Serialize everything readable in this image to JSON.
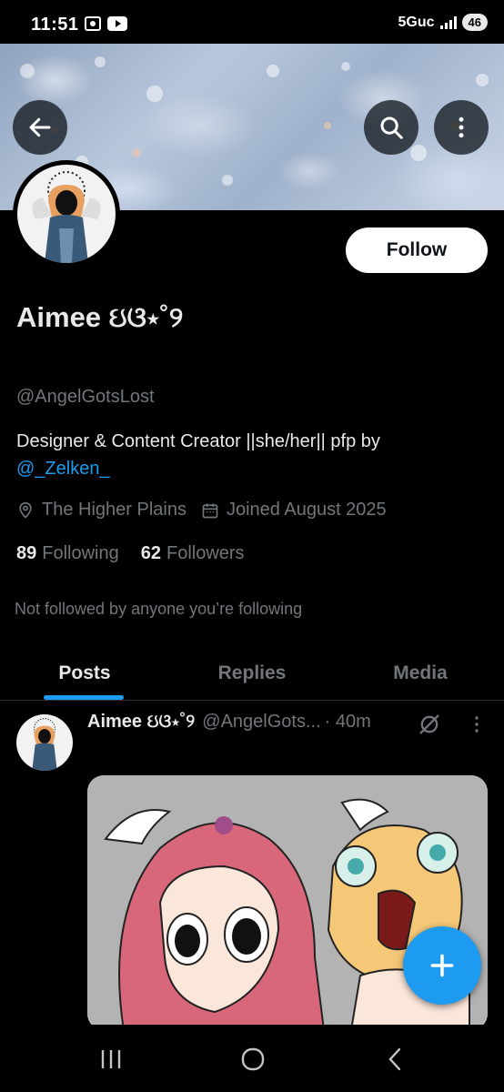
{
  "status_bar": {
    "time": "11:51",
    "network": "5Guc",
    "battery": "46"
  },
  "profile": {
    "display_name": "Aimee ઇଓ⋆˚୨",
    "handle": "@AngelGotsLost",
    "bio_text": "Designer & Content Creator ||she/her|| pfp by",
    "bio_mention": "@_Zelken_",
    "location": "The Higher Plains",
    "joined": "Joined August 2025",
    "following_count": "89",
    "following_label": "Following",
    "followers_count": "62",
    "followers_label": "Followers",
    "not_followed_text": "Not followed by anyone you’re following",
    "follow_button": "Follow"
  },
  "tabs": [
    {
      "label": "Posts",
      "active": true
    },
    {
      "label": "Replies",
      "active": false
    },
    {
      "label": "Media",
      "active": false
    }
  ],
  "post": {
    "name": "Aimee ઇଓ⋆˚୨",
    "handle": "@AngelGots...",
    "time": "· 40m"
  },
  "icons": {
    "back": "arrow-left-icon",
    "search": "search-icon",
    "more": "more-vertical-icon",
    "location": "location-pin-icon",
    "calendar": "calendar-icon",
    "grok": "grok-icon",
    "compose": "plus-icon"
  },
  "colors": {
    "accent": "#1d9bf0",
    "background": "#000000",
    "muted": "#71767b",
    "text": "#e7e9ea"
  }
}
